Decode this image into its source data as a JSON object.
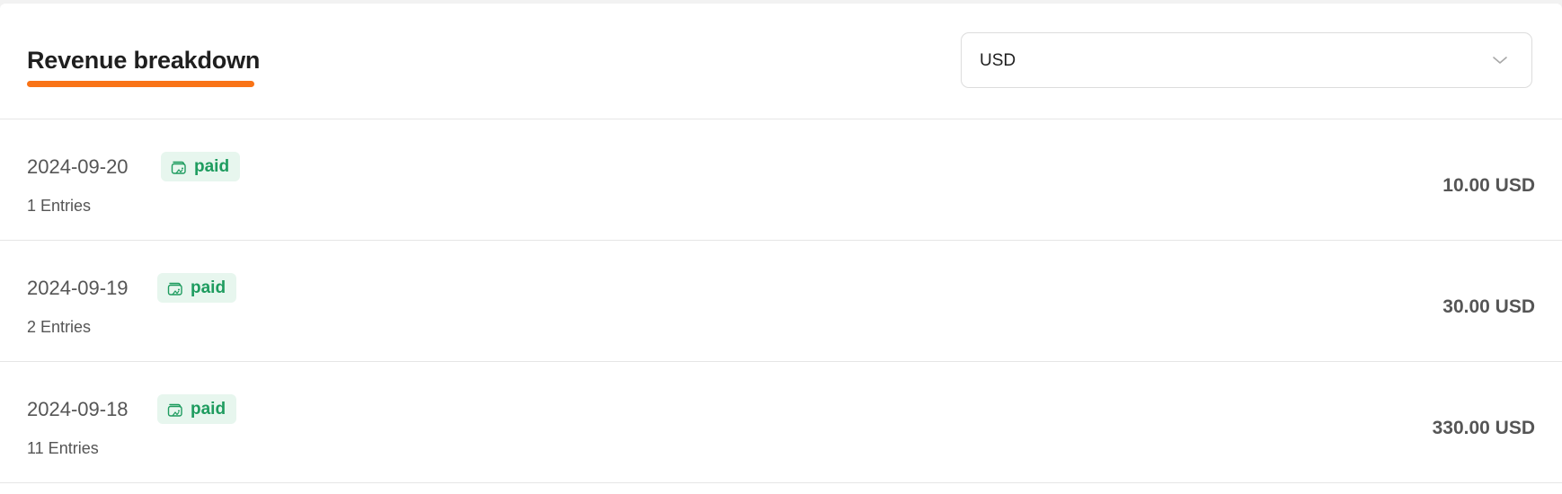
{
  "header": {
    "title": "Revenue breakdown",
    "accent_color": "#f97316"
  },
  "currency_select": {
    "value": "USD",
    "icon": "chevron-down-icon"
  },
  "rows": [
    {
      "date": "2024-09-20",
      "status": "paid",
      "entries": "1 Entries",
      "amount": "10.00 USD"
    },
    {
      "date": "2024-09-19",
      "status": "paid",
      "entries": "2 Entries",
      "amount": "30.00 USD"
    },
    {
      "date": "2024-09-18",
      "status": "paid",
      "entries": "11 Entries",
      "amount": "330.00 USD"
    }
  ],
  "status_badge": {
    "icon": "wallet-icon",
    "color": "#1e9c5f",
    "background": "#e7f6ee"
  }
}
